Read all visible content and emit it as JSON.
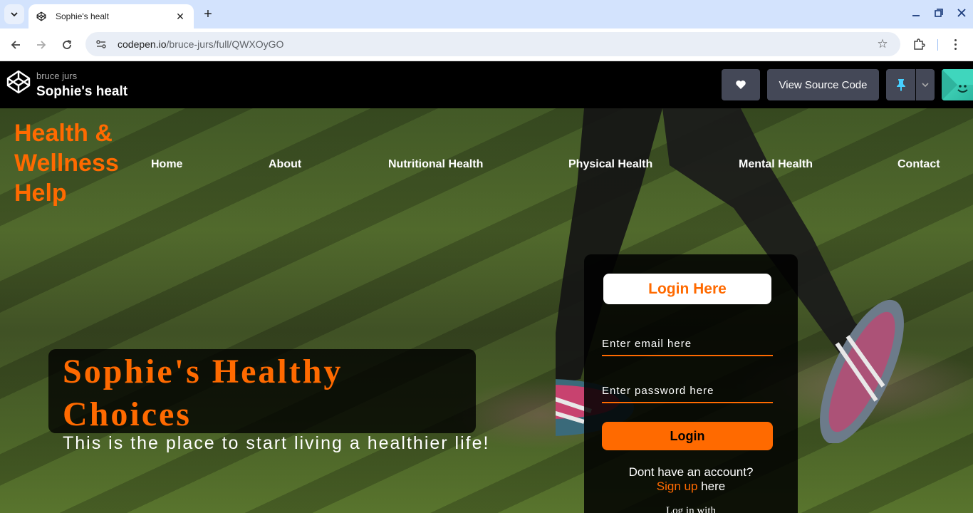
{
  "browser": {
    "tab_title": "Sophie's healt",
    "url_host": "codepen.io",
    "url_path": "/bruce-jurs/full/QWXOyGO"
  },
  "codepen": {
    "author": "bruce jurs",
    "pen_title": "Sophie's healt",
    "view_source_label": "View Source Code"
  },
  "site": {
    "logo_lines": [
      "Health &",
      "Wellness",
      "Help"
    ],
    "nav": [
      "Home",
      "About",
      "Nutritional Health",
      "Physical Health",
      "Mental Health",
      "Contact"
    ],
    "hero_title": "Sophie's Healthy Choices",
    "hero_subtitle": "This is the place to start living a healthier life!"
  },
  "login": {
    "heading": "Login Here",
    "email_placeholder": "Enter email here",
    "password_placeholder": "Enter password here",
    "button_label": "Login",
    "no_account": "Dont have an account?",
    "signup_link": "Sign up",
    "signup_suffix": " here",
    "login_with": "Log in with"
  },
  "colors": {
    "accent": "#ff6a00",
    "chrome_tabstrip": "#d3e3fd",
    "codepen_button": "#444857"
  }
}
